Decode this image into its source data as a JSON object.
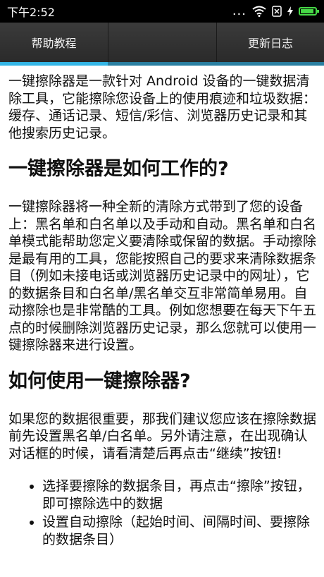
{
  "status": {
    "time": "下午2:52",
    "dots": "..."
  },
  "tabs": [
    {
      "label": "帮助教程"
    },
    {
      "label": ""
    },
    {
      "label": "更新日志"
    }
  ],
  "content": {
    "intro": "一键擦除器是一款针对 Android 设备的一键数据清除工具，它能擦除您设备上的使用痕迹和垃圾数据：缓存、通话记录、短信/彩信、浏览器历史记录和其他搜索历史记录。",
    "heading1": "一键擦除器是如何工作的?",
    "para1": "一键擦除器将一种全新的清除方式带到了您的设备上：黑名单和白名单以及手动和自动。黑名单和白名单模式能帮助您定义要清除或保留的数据。手动擦除是最有用的工具，您能按照自己的要求来清除数据条目（例如未接电话或浏览器历史记录中的网址），它的数据条目和白名单/黑名单交互非常简单易用。自动擦除也是非常酷的工具。例如您想要在每天下午五点的时候删除浏览器历史记录，那么您就可以使用一键擦除器来进行设置。",
    "heading2": "如何使用一键擦除器?",
    "para2": "如果您的数据很重要，那我们建议您应该在擦除数据前先设置黑名单/白名单。另外请注意，在出现确认对话框的时候，请看清楚后再点击“继续”按钮!",
    "bullets": [
      "选择要擦除的数据条目，再点击“擦除”按钮，即可擦除选中的数据",
      "设置自动擦除（起始时间、间隔时间、要擦除的数据条目）"
    ]
  }
}
